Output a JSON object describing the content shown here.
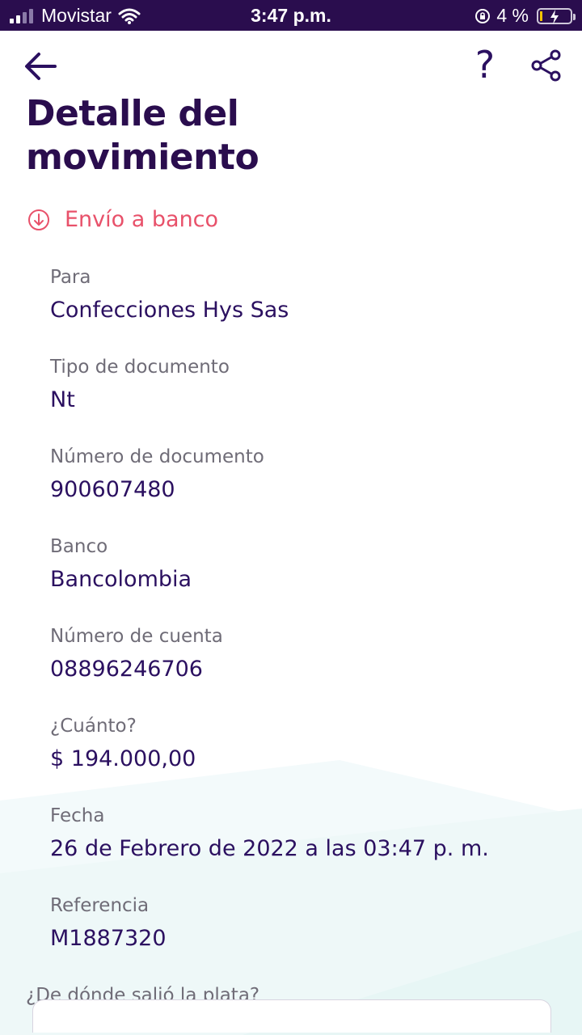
{
  "status_bar": {
    "carrier": "Movistar",
    "time": "3:47 p.m.",
    "battery": "4 %"
  },
  "header": {
    "back_icon": "arrow-left-icon",
    "help_icon": "?",
    "share_icon": "share-icon",
    "title": "Detalle del movimiento"
  },
  "transaction": {
    "type_icon": "arrow-down-circle-icon",
    "type_label": "Envío a banco",
    "type_color": "#e8516a"
  },
  "fields": [
    {
      "label": "Para",
      "value": "Confecciones Hys Sas"
    },
    {
      "label": "Tipo de documento",
      "value": "Nt"
    },
    {
      "label": "Número de documento",
      "value": "900607480"
    },
    {
      "label": "Banco",
      "value": "Bancolombia"
    },
    {
      "label": "Número de cuenta",
      "value": "08896246706"
    },
    {
      "label": "¿Cuánto?",
      "value": "$ 194.000,00"
    },
    {
      "label": "Fecha",
      "value": "26 de Febrero de 2022 a las 03:47 p. m."
    },
    {
      "label": "Referencia",
      "value": "M1887320"
    }
  ],
  "source": {
    "label": "¿De dónde salió la plata?"
  },
  "colors": {
    "primary": "#2b1060",
    "status_bar": "#2a0d4e",
    "accent": "#e8516a",
    "muted": "#6f6c77"
  }
}
